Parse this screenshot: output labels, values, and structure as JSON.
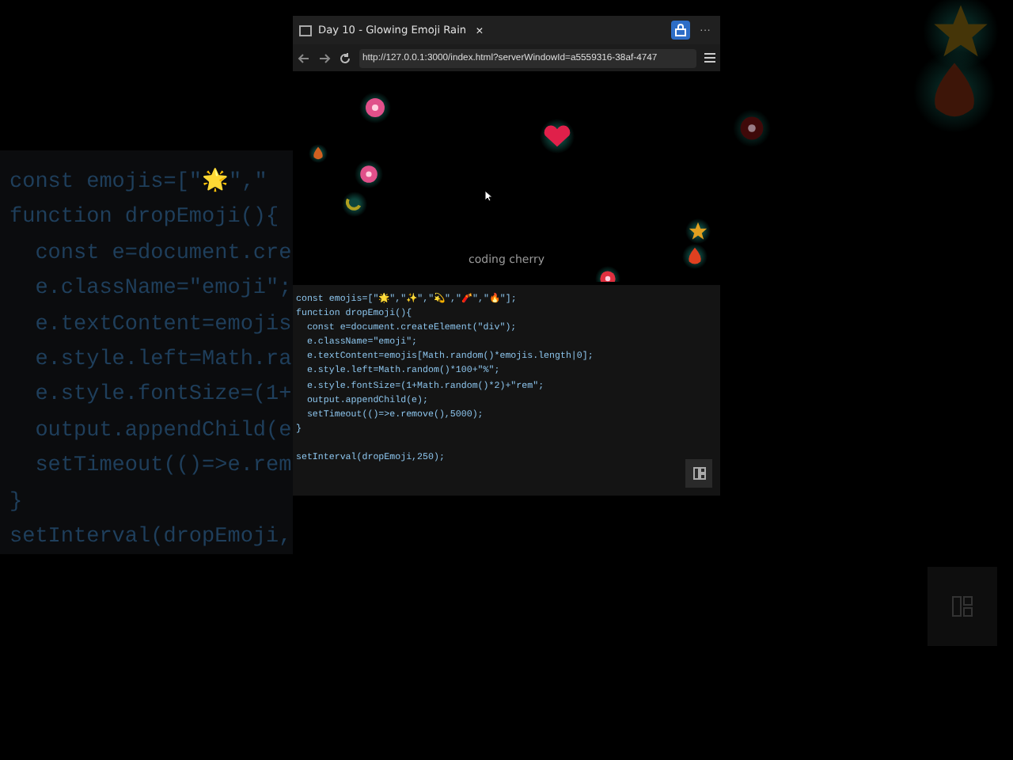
{
  "browser": {
    "tab_title": "Day 10 - Glowing Emoji Rain",
    "close_glyph": "×",
    "menu_glyph": "···",
    "url": "http://127.0.0.1:3000/index.html?serverWindowId=a5559316-38af-4747"
  },
  "preview": {
    "caption": "coding cherry"
  },
  "code": {
    "blocks": [
      [
        "const emojis=[\"🌟\",\"✨\",\"💫\",\"🧨\",\"🔥\"];",
        "function dropEmoji(){",
        "  const e=document.createElement(\"div\");",
        "  e.className=\"emoji\";",
        "  e.textContent=emojis[Math.random()*emojis.length|0];",
        "  e.style.left=Math.random()*100+\"%\";",
        "  e.style.fontSize=(1+Math.random()*2)+\"rem\";",
        "  output.appendChild(e);",
        "  setTimeout(()=>e.remove(),5000);",
        "}"
      ],
      [
        "setInterval(dropEmoji,250);"
      ]
    ]
  },
  "background_code": {
    "lines": [
      "const emojis=[\"🌟\",\"",
      "function dropEmoji(){",
      "  const e=document.cre",
      "  e.className=\"emoji\";",
      "  e.textContent=emojis",
      "  e.style.left=Math.ra",
      "  e.style.fontSize=(1+",
      "  output.appendChild(e",
      "  setTimeout(()=>e.rem",
      "}",
      "setInterval(dropEmoji,"
    ]
  }
}
